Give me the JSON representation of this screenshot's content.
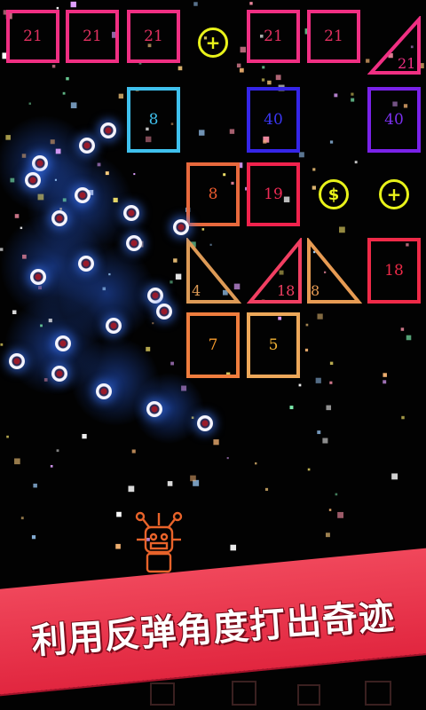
{
  "blocks": [
    {
      "label": "21",
      "color": "#f02f83",
      "text_color": "#e03060"
    },
    {
      "label": "21",
      "color": "#f02f83",
      "text_color": "#e03060"
    },
    {
      "label": "21",
      "color": "#f02f83",
      "text_color": "#e03060"
    },
    {
      "label": "21",
      "color": "#f02f83",
      "text_color": "#e03060"
    },
    {
      "label": "21",
      "color": "#f02f83",
      "text_color": "#e03060"
    },
    {
      "label": "8",
      "color": "#3fc1ee",
      "text_color": "#3fc1ee"
    },
    {
      "label": "40",
      "color": "#3525e8",
      "text_color": "#3a36f2"
    },
    {
      "label": "40",
      "color": "#7a22ea",
      "text_color": "#7b30f0"
    },
    {
      "label": "8",
      "color": "#e8693d",
      "text_color": "#ec5b2e"
    },
    {
      "label": "19",
      "color": "#f0224d",
      "text_color": "#ee2a55"
    },
    {
      "label": "18",
      "color": "#ef2a48",
      "text_color": "#ee2a48"
    },
    {
      "label": "7",
      "color": "#ef7d3e",
      "text_color": "#f59a2c"
    },
    {
      "label": "5",
      "color": "#eda85a",
      "text_color": "#f2b234"
    }
  ],
  "triangles": [
    {
      "label": "21",
      "color": "#f02f83"
    },
    {
      "label": "4",
      "color": "#dd9a56"
    },
    {
      "label": "18",
      "color": "#f13f62"
    },
    {
      "label": "8",
      "color": "#e79b53"
    }
  ],
  "pickups": [
    {
      "icon": "plus-icon",
      "glyph": "+"
    },
    {
      "icon": "dollar-coin-icon",
      "glyph": "$"
    },
    {
      "icon": "plus-icon",
      "glyph": "+"
    }
  ],
  "launcher_icon": "robot-launcher-icon",
  "banner": {
    "text": "利用反弹角度打出奇迹",
    "color": "#e8304a"
  }
}
